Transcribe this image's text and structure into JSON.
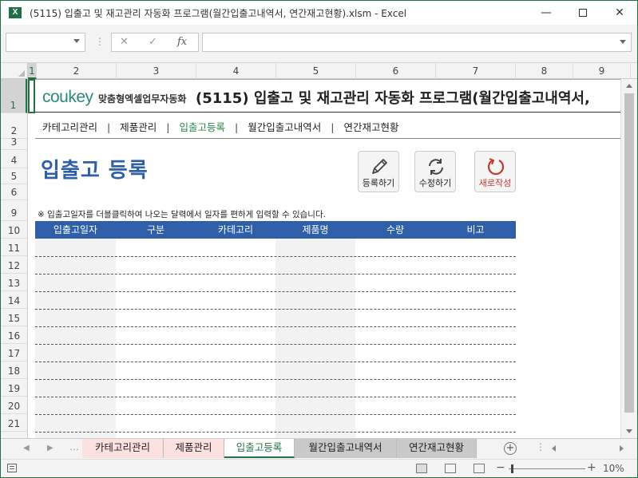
{
  "window": {
    "title": "(5115) 입출고 및 재고관리 자동화 프로그램(월간입출고내역서, 연간재고현황).xlsm  -  Excel",
    "app_icon": "X"
  },
  "formula_bar": {
    "cancel": "✕",
    "enter": "✓",
    "fx": "fx"
  },
  "columns": [
    "1",
    "2",
    "3",
    "4",
    "5",
    "6",
    "7",
    "8",
    "9"
  ],
  "rows": [
    "1",
    "2",
    "3",
    "4",
    "5",
    "6",
    "9",
    "10",
    "11",
    "12",
    "13",
    "14",
    "15",
    "16",
    "17",
    "18",
    "19",
    "20",
    "21"
  ],
  "header": {
    "logo_cou": "cou",
    "logo_key": "key",
    "tagline": "맞춤형엑셀업무자동화",
    "title": "(5115) 입출고 및 재고관리 자동화 프로그램(월간입출고내역서,"
  },
  "nav": {
    "items": [
      {
        "label": "카테고리관리",
        "active": false
      },
      {
        "label": "제품관리",
        "active": false
      },
      {
        "label": "입출고등록",
        "active": true
      },
      {
        "label": "월간입출고내역서",
        "active": false
      },
      {
        "label": "연간재고현황",
        "active": false
      }
    ],
    "separator": "|"
  },
  "page": {
    "title": "입출고 등록",
    "note": "※ 입출고일자를 더블클릭하여 나오는 달력에서 일자를 편하게 입력할 수 있습니다."
  },
  "actions": {
    "register": "등록하기",
    "edit": "수정하기",
    "new": "새로작성"
  },
  "table": {
    "headers": [
      "입출고일자",
      "구분",
      "카테고리",
      "제품명",
      "수량",
      "비고"
    ],
    "row_count": 11
  },
  "sheet_tabs": [
    {
      "label": "카테고리관리",
      "style": "pink"
    },
    {
      "label": "제품관리",
      "style": "pink"
    },
    {
      "label": "입출고등록",
      "style": "active"
    },
    {
      "label": "월간입출고내역서",
      "style": "gray"
    },
    {
      "label": "연간재고현황",
      "style": "gray"
    }
  ],
  "status": {
    "zoom": "10%",
    "zoom_fraction": 0.1
  },
  "colors": {
    "accent": "#217346",
    "table_header": "#2e5fa8",
    "title_blue": "#2e5fa8",
    "nav_active": "#2a8a4a",
    "new_button": "#c0392b"
  }
}
